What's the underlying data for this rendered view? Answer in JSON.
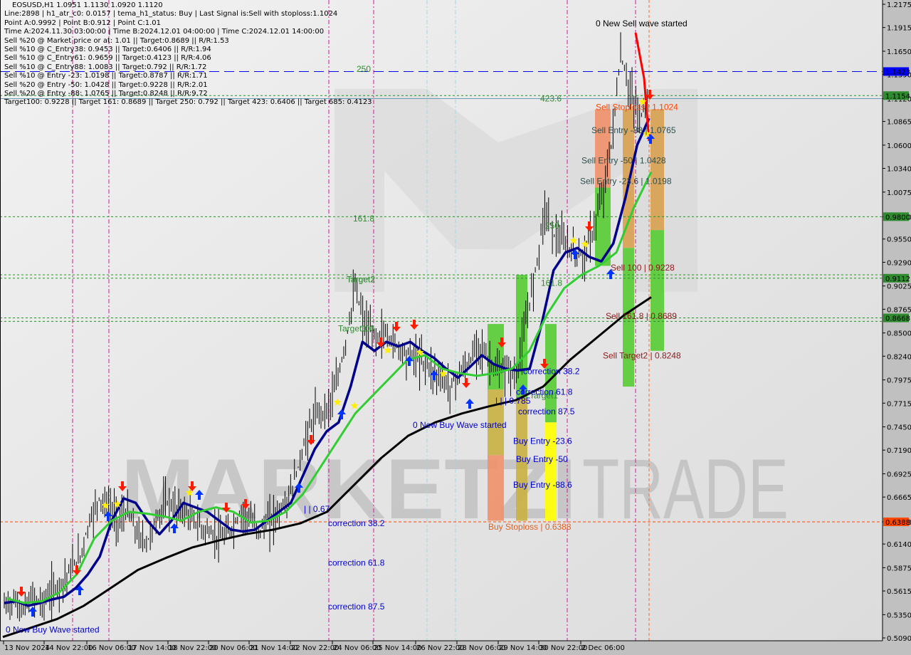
{
  "window": {
    "symbol_line": "EOSUSD,H1  1.0951 1.1130 1.0920 1.1120"
  },
  "info_lines": [
    "Line:2898 | h1_atr_c0: 0.0157 | tema_h1_status: Buy | Last Signal is:Sell with stoploss:1.1024",
    "Point A:0.9992 | Point B:0.912 | Point C:1.01",
    "Time A:2024.11.30 03:00:00 | Time B:2024.12.01 04:00:00 | Time C:2024.12.01 14:00:00",
    "Sell %20 @ Market price or at: 1.01 || Target:0.8689 || R/R:1.53",
    "Sell %10 @ C_Entry38: 0.9453 || Target:0.6406 || R/R:1.94",
    "Sell %10 @ C_Entry61: 0.9659 || Target:0.4123 || R/R:4.06",
    "Sell %10 @ C_Entry88: 1.0083 || Target:0.792 || R/R:1.72",
    "Sell %10 @ Entry -23: 1.0198 || Target:0.8787 || R/R:1.71",
    "Sell %20 @ Entry -50: 1.0428 || Target:0.9228 || R/R:2.01",
    "Sell %20 @ Entry -88: 1.0765 || Target:0.8248 || R/R:9.72",
    "Target100: 0.9228 || Target 161: 0.8689 || Target 250: 0.792 || Target 423: 0.6406 || Target 685: 0.4123"
  ],
  "watermark": {
    "text_left": "MARKETZI",
    "text_right": "TRADE"
  },
  "chart_data": {
    "type": "line",
    "title": "EOSUSD,H1",
    "ohlc_last": {
      "open": 1.0951,
      "high": 1.113,
      "low": 1.092,
      "close": 1.112
    },
    "ylim": [
      0.509,
      1.2175
    ],
    "y_ticks": [
      "1.2175",
      "1.1915",
      "1.1650",
      "1.1390",
      "1.1120",
      "1.0865",
      "1.0600",
      "1.0340",
      "1.0075",
      "0.9800",
      "0.9550",
      "0.9290",
      "0.9025",
      "0.8765",
      "0.8500",
      "0.8240",
      "0.7975",
      "0.7715",
      "0.7450",
      "0.7190",
      "0.6925",
      "0.6665",
      "0.6388",
      "0.6140",
      "0.5875",
      "0.5615",
      "0.5350",
      "0.5090"
    ],
    "x_ticks": [
      "13 Nov 2024",
      "14 Nov 22:00",
      "16 Nov 06:00",
      "17 Nov 14:00",
      "18 Nov 22:00",
      "20 Nov 06:00",
      "21 Nov 14:00",
      "22 Nov 22:00",
      "24 Nov 06:00",
      "25 Nov 14:00",
      "26 Nov 22:00",
      "28 Nov 06:00",
      "29 Nov 14:00",
      "30 Nov 22:00",
      "2 Dec 06:00"
    ],
    "price_tags": [
      {
        "value": "1.1423",
        "color": "#0000ff"
      },
      {
        "value": "1.1154",
        "color": "#2e8b2e"
      },
      {
        "value": "0.9800",
        "color": "#2e8b2e"
      },
      {
        "value": "0.9112",
        "color": "#2e8b2e"
      },
      {
        "value": "0.8668",
        "color": "#2e8b2e"
      },
      {
        "value": "0.6388",
        "color": "#ff4500"
      }
    ],
    "h_levels": [
      {
        "price": 1.1423,
        "style": "blue-dash"
      },
      {
        "price": 1.1154,
        "style": "green-dot"
      },
      {
        "price": 1.112,
        "style": "steel-solid"
      },
      {
        "price": 0.98,
        "style": "green-dot"
      },
      {
        "price": 0.915,
        "style": "green-dot"
      },
      {
        "price": 0.9112,
        "style": "green-dot"
      },
      {
        "price": 0.8668,
        "style": "green-dot"
      },
      {
        "price": 0.863,
        "style": "green-dot"
      },
      {
        "price": 0.6388,
        "style": "orange-dot"
      }
    ],
    "series": [
      {
        "name": "price_close",
        "color": "#000000",
        "values": [
          0.545,
          0.55,
          0.54,
          0.555,
          0.548,
          0.56,
          0.57,
          0.585,
          0.6,
          0.64,
          0.665,
          0.655,
          0.64,
          0.65,
          0.625,
          0.615,
          0.64,
          0.66,
          0.655,
          0.65,
          0.64,
          0.63,
          0.625,
          0.62,
          0.63,
          0.65,
          0.64,
          0.63,
          0.64,
          0.65,
          0.665,
          0.7,
          0.74,
          0.76,
          0.765,
          0.79,
          0.84,
          0.9,
          0.86,
          0.845,
          0.85,
          0.84,
          0.83,
          0.825,
          0.82,
          0.81,
          0.8,
          0.79,
          0.805,
          0.815,
          0.84,
          0.82,
          0.805,
          0.81,
          0.8,
          0.86,
          0.92,
          0.99,
          0.96,
          0.95,
          0.94,
          0.935,
          0.96,
          1.0,
          1.06,
          1.16,
          1.12,
          1.09,
          1.112
        ]
      },
      {
        "name": "tema_blue",
        "color": "#00008b",
        "values": [
          0.548,
          0.55,
          0.545,
          0.548,
          0.552,
          0.555,
          0.565,
          0.58,
          0.6,
          0.64,
          0.665,
          0.66,
          0.64,
          0.625,
          0.64,
          0.66,
          0.655,
          0.65,
          0.64,
          0.63,
          0.628,
          0.63,
          0.64,
          0.65,
          0.66,
          0.69,
          0.72,
          0.74,
          0.75,
          0.79,
          0.84,
          0.83,
          0.84,
          0.835,
          0.84,
          0.83,
          0.822,
          0.81,
          0.8,
          0.812,
          0.825,
          0.815,
          0.81,
          0.808,
          0.81,
          0.86,
          0.92,
          0.94,
          0.945,
          0.935,
          0.93,
          0.95,
          1.0,
          1.06,
          1.09
        ]
      },
      {
        "name": "ema_green",
        "color": "#32cd32",
        "values": [
          0.553,
          0.548,
          0.55,
          0.56,
          0.58,
          0.62,
          0.64,
          0.65,
          0.648,
          0.645,
          0.64,
          0.65,
          0.655,
          0.65,
          0.638,
          0.64,
          0.65,
          0.67,
          0.7,
          0.73,
          0.76,
          0.78,
          0.8,
          0.82,
          0.825,
          0.81,
          0.805,
          0.802,
          0.805,
          0.81,
          0.83,
          0.87,
          0.9,
          0.915,
          0.925,
          0.94,
          0.99,
          1.03
        ]
      },
      {
        "name": "sma_black",
        "color": "#000000",
        "values": [
          0.51,
          0.52,
          0.53,
          0.545,
          0.565,
          0.585,
          0.598,
          0.61,
          0.618,
          0.625,
          0.63,
          0.637,
          0.65,
          0.68,
          0.71,
          0.735,
          0.75,
          0.76,
          0.768,
          0.775,
          0.79,
          0.82,
          0.845,
          0.87,
          0.89
        ]
      }
    ],
    "zones": [
      {
        "name": "buy-zone-1",
        "top": 0.86,
        "bottom": 0.64,
        "segments": [
          "#55cc33",
          "#c8b040",
          "#f0906a"
        ]
      },
      {
        "name": "buy-zone-2",
        "top": 0.915,
        "bottom": 0.64,
        "segments": [
          "#55cc33",
          "#c8b040"
        ]
      },
      {
        "name": "buy-zone-3",
        "top": 0.86,
        "bottom": 0.64,
        "segments": [
          "#55cc33",
          "#ffff00"
        ]
      },
      {
        "name": "sell-zone-1",
        "top": 1.1,
        "bottom": 0.925,
        "segments": [
          "#f0906a",
          "#55cc33"
        ]
      },
      {
        "name": "sell-zone-2",
        "top": 1.1,
        "bottom": 0.79,
        "segments": [
          "#d8a050",
          "#55cc33"
        ]
      },
      {
        "name": "sell-zone-3",
        "top": 1.1,
        "bottom": 0.83,
        "segments": [
          "#d8a050",
          "#55cc33"
        ]
      }
    ],
    "annotations": [
      {
        "text": "0 New Sell wave started",
        "price": 1.196,
        "color": "#000000"
      },
      {
        "text": "Sell Stoploss | 1.1024",
        "price": 1.1024,
        "color": "#ff4500"
      },
      {
        "text": "Sell Entry -88 | 1.0765",
        "price": 1.0765,
        "color": "#2f4f4f"
      },
      {
        "text": "Sell Entry -50 | 1.0428",
        "price": 1.0428,
        "color": "#2f4f4f"
      },
      {
        "text": "Sell Entry -23.6 | 1.0198",
        "price": 1.0198,
        "color": "#2f4f4f"
      },
      {
        "text": "Sell 100 | 0.9228",
        "price": 0.9228,
        "color": "#8b1a1a"
      },
      {
        "text": "Sell 161.8 | 0.8689",
        "price": 0.8689,
        "color": "#8b1a1a"
      },
      {
        "text": "Sell Target2 | 0.8248",
        "price": 0.8248,
        "color": "#8b1a1a"
      },
      {
        "text": "250",
        "price": 1.145,
        "color": "#2e8b2e"
      },
      {
        "text": "423.6",
        "price": 1.112,
        "color": "#2e8b2e"
      },
      {
        "text": "161.8",
        "price": 0.978,
        "color": "#2e8b2e"
      },
      {
        "text": "250",
        "price": 0.97,
        "color": "#2e8b2e"
      },
      {
        "text": "Target2",
        "price": 0.91,
        "color": "#2e8b2e"
      },
      {
        "text": "161.8",
        "price": 0.906,
        "color": "#2e8b2e"
      },
      {
        "text": "Target2",
        "price": 0.91,
        "color": "#2e8b2e"
      },
      {
        "text": "100",
        "price": 0.855,
        "color": "#2e8b2e"
      },
      {
        "text": "Target1",
        "price": 0.855,
        "color": "#2e8b2e"
      },
      {
        "text": "Target1",
        "price": 0.78,
        "color": "#2e8b2e"
      },
      {
        "text": "correction 38.2",
        "price": 0.807,
        "color": "#0000cd"
      },
      {
        "text": "correction 61.8",
        "price": 0.784,
        "color": "#0000cd"
      },
      {
        "text": "| | | 0.785",
        "price": 0.774,
        "color": "#0000cd"
      },
      {
        "text": "correction 87.5",
        "price": 0.762,
        "color": "#0000cd"
      },
      {
        "text": "0 New Buy Wave started",
        "price": 0.747,
        "color": "#0000cd"
      },
      {
        "text": "Buy Entry -23.6",
        "price": 0.729,
        "color": "#0000cd"
      },
      {
        "text": "Buy Entry -50",
        "price": 0.709,
        "color": "#0000cd"
      },
      {
        "text": "Buy Entry -88.6",
        "price": 0.68,
        "color": "#0000cd"
      },
      {
        "text": "Buy Stoploss | 0.6388",
        "price": 0.633,
        "color": "#e06020"
      },
      {
        "text": "| | 0.67",
        "price": 0.653,
        "color": "#0000cd"
      },
      {
        "text": "correction 38.2",
        "price": 0.637,
        "color": "#0000cd"
      },
      {
        "text": "correction 61.8",
        "price": 0.593,
        "color": "#0000cd"
      },
      {
        "text": "correction 87.5",
        "price": 0.544,
        "color": "#0000cd"
      },
      {
        "text": "0 New Buy Wave started",
        "price": 0.518,
        "color": "#0000cd"
      }
    ]
  }
}
